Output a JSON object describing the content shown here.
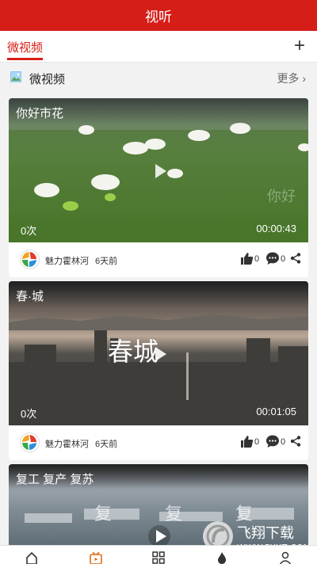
{
  "header": {
    "title": "视听"
  },
  "tabs": {
    "active_label": "微视频",
    "add_icon": "plus-icon"
  },
  "section": {
    "title": "微视频",
    "more_label": "更多 ",
    "icon": "picture-icon"
  },
  "videos": [
    {
      "title": "你好市花",
      "views": "0次",
      "duration": "00:00:43",
      "overlay_text": "你好",
      "author": "魅力霍林河",
      "time": "6天前",
      "likes": "0",
      "comments": "0"
    },
    {
      "title": "春·城",
      "views": "0次",
      "duration": "00:01:05",
      "overlay_text": "春城",
      "author": "魅力霍林河",
      "time": "6天前",
      "likes": "0",
      "comments": "0"
    },
    {
      "title": "复工 复产 复苏",
      "overlay_text": "复 复 复"
    }
  ],
  "bottom_nav": {
    "items": [
      "home-icon",
      "video-icon",
      "grid-icon",
      "fire-icon",
      "user-icon"
    ]
  },
  "watermark": {
    "title": "飞翔下载",
    "domain": "WWW.FXXZ.COM"
  },
  "colors": {
    "brand_red": "#d51e17"
  }
}
